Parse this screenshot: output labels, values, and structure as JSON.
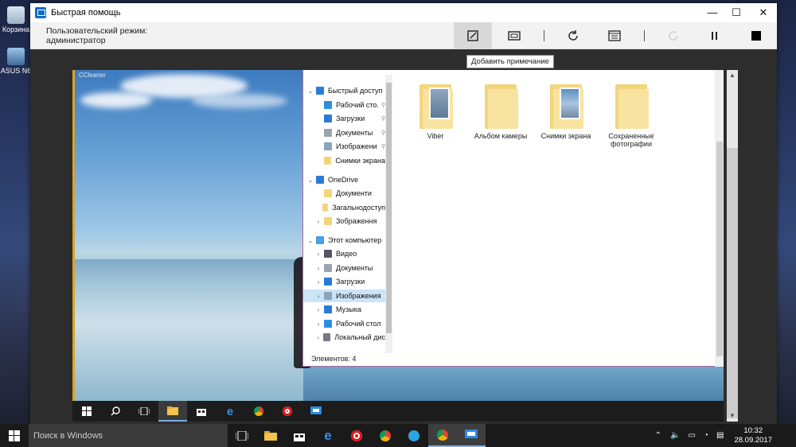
{
  "window": {
    "title": "Быстрая помощь",
    "minimize": "—",
    "maximize": "☐",
    "close": "✕"
  },
  "toolbar": {
    "mode_line1": "Пользовательский режим:",
    "mode_line2": "администратор",
    "buttons": [
      "annotate-icon",
      "fit-screen-icon",
      "restart-icon",
      "task-manager-icon",
      "reconnect-icon",
      "pause-icon",
      "stop-icon"
    ],
    "tooltip": "Добавить примечание"
  },
  "desktop": {
    "icons": [
      "Корзина",
      "ASUS N6"
    ]
  },
  "remote": {
    "watermark": "CCleaner",
    "explorer": {
      "nav": [
        {
          "label": "Быстрый доступ",
          "icon": "star-icon",
          "color": "#2b7bd6",
          "chev": "⌄",
          "pin": false,
          "selected": false
        },
        {
          "label": "Рабочий сто.",
          "icon": "desktop-icon",
          "color": "#2b8fdc",
          "chev": "",
          "pin": true,
          "selected": false
        },
        {
          "label": "Загрузки",
          "icon": "download-icon",
          "color": "#2b7bd6",
          "chev": "",
          "pin": true,
          "selected": false
        },
        {
          "label": "Документы",
          "icon": "document-icon",
          "color": "#9aa4b0",
          "chev": "",
          "pin": true,
          "selected": false
        },
        {
          "label": "Изображени",
          "icon": "pictures-icon",
          "color": "#8aa4b8",
          "chev": "",
          "pin": true,
          "selected": false
        },
        {
          "label": "Снимки экрана",
          "icon": "folder-icon",
          "color": "#f3d57e",
          "chev": "",
          "pin": false,
          "selected": false
        },
        {
          "label": "OneDrive",
          "icon": "cloud-icon",
          "color": "#2b7bd6",
          "chev": "⌄",
          "pin": false,
          "selected": false
        },
        {
          "label": "Документи",
          "icon": "folder-icon",
          "color": "#f3d57e",
          "chev": "",
          "pin": false,
          "selected": false
        },
        {
          "label": "Загальнодоступ",
          "icon": "folder-icon",
          "color": "#f3d57e",
          "chev": "",
          "pin": false,
          "selected": false
        },
        {
          "label": "Зображення",
          "icon": "folder-icon",
          "color": "#f3d57e",
          "chev": "›",
          "pin": false,
          "selected": false
        },
        {
          "label": "Этот компьютер",
          "icon": "computer-icon",
          "color": "#4aa0e6",
          "chev": "⌄",
          "pin": false,
          "selected": false
        },
        {
          "label": "Видео",
          "icon": "video-icon",
          "color": "#556",
          "chev": "›",
          "pin": false,
          "selected": false
        },
        {
          "label": "Документы",
          "icon": "document-icon",
          "color": "#9aa4b0",
          "chev": "›",
          "pin": false,
          "selected": false
        },
        {
          "label": "Загрузки",
          "icon": "download-icon",
          "color": "#2b7bd6",
          "chev": "›",
          "pin": false,
          "selected": false
        },
        {
          "label": "Изображения",
          "icon": "pictures-icon",
          "color": "#8aa4b8",
          "chev": "›",
          "pin": false,
          "selected": true
        },
        {
          "label": "Музыка",
          "icon": "music-icon",
          "color": "#2b7bd6",
          "chev": "›",
          "pin": false,
          "selected": false
        },
        {
          "label": "Рабочий стол",
          "icon": "desktop-icon",
          "color": "#2b8fdc",
          "chev": "›",
          "pin": false,
          "selected": false
        },
        {
          "label": "Локальный дис",
          "icon": "drive-icon",
          "color": "#778",
          "chev": "›",
          "pin": false,
          "selected": false
        }
      ],
      "folders": [
        {
          "name": "Viber",
          "has_pic": true
        },
        {
          "name": "Альбом камеры",
          "has_pic": false
        },
        {
          "name": "Снимки экрана",
          "has_pic": true
        },
        {
          "name": "Сохраненные фотографии",
          "has_pic": false
        }
      ],
      "status": "Элементов: 4"
    },
    "taskbar": [
      "windows-logo-icon",
      "search-icon",
      "task-view-icon",
      "file-explorer-icon",
      "store-icon",
      "edge-icon",
      "chrome-icon",
      "opera-icon",
      "quick-assist-icon"
    ]
  },
  "taskbar": {
    "search_placeholder": "Поиск в Windows",
    "apps": [
      "task-view-icon",
      "file-explorer-icon",
      "store-icon",
      "edge-icon",
      "opera-icon",
      "chrome-icon",
      "telegram-icon",
      "chrome-alt-icon",
      "quick-assist-icon"
    ],
    "time": "10:32",
    "date": "28.09.2017"
  }
}
